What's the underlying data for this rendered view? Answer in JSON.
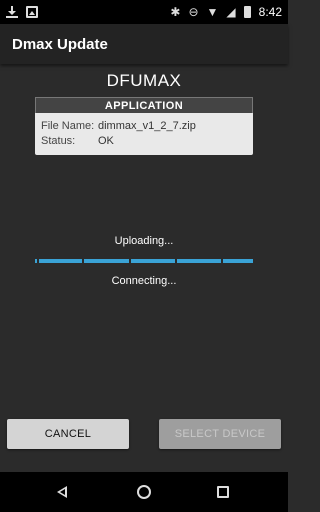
{
  "status_bar": {
    "time": "8:42",
    "left_icons": [
      "download-icon",
      "image-icon"
    ],
    "right_icons": [
      "bluetooth-icon",
      "do-not-disturb-icon",
      "wifi-icon",
      "signal-icon",
      "battery-icon"
    ]
  },
  "app_bar": {
    "title": "Dmax Update"
  },
  "main": {
    "device_title": "DFUMAX",
    "card": {
      "header": "APPLICATION",
      "file_name_label": "File Name:",
      "file_name_value": "dimmax_v1_2_7.zip",
      "status_label": "Status:",
      "status_value": "OK"
    },
    "uploading_text": "Uploading...",
    "progress": {
      "fraction": 1.0,
      "color": "#3aa3d6"
    },
    "connecting_text": "Connecting..."
  },
  "buttons": {
    "cancel": "CANCEL",
    "select_device": "SELECT DEVICE"
  },
  "nav_bar": {
    "icons": [
      "back-icon",
      "home-icon",
      "recents-icon"
    ]
  }
}
